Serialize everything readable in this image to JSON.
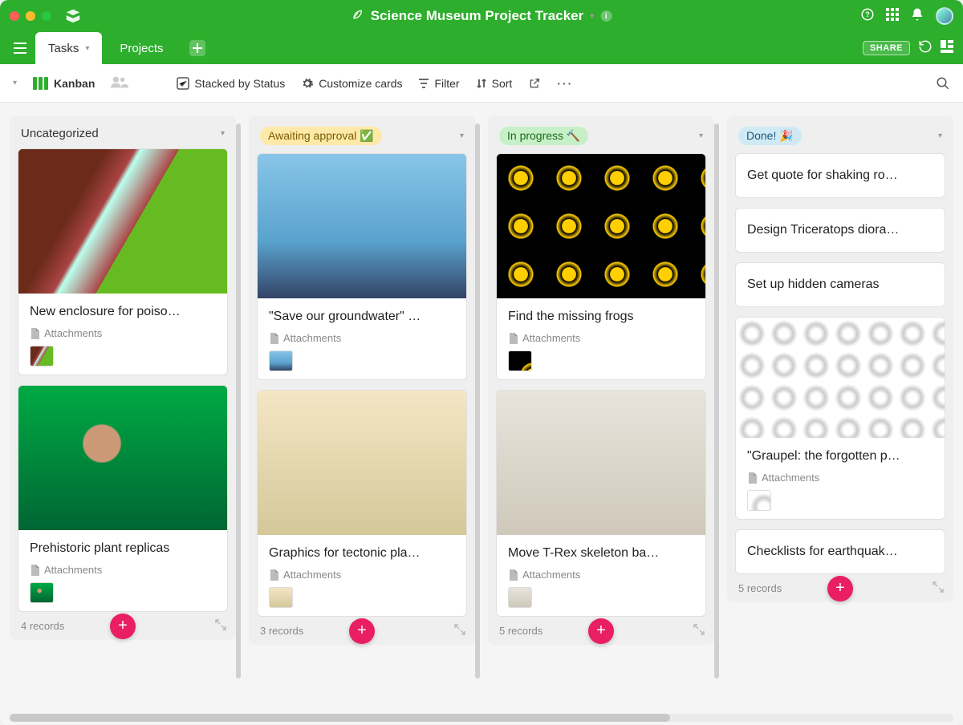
{
  "header": {
    "title": "Science Museum Project Tracker"
  },
  "tabs": {
    "tasks": "Tasks",
    "projects": "Projects"
  },
  "topbar_right": {
    "share": "SHARE"
  },
  "toolbar": {
    "view_name": "Kanban",
    "stacked": "Stacked by Status",
    "customize": "Customize cards",
    "filter": "Filter",
    "sort": "Sort"
  },
  "columns": [
    {
      "title": "Uncategorized",
      "pill_class": "",
      "emoji": "",
      "footer": "4 records",
      "cards": [
        {
          "title": "New enclosure for poiso…",
          "attachments": "Attachments",
          "image": "img-frog1",
          "has_image": true
        },
        {
          "title": "Prehistoric plant replicas",
          "attachments": "Attachments",
          "image": "img-plant",
          "has_image": true
        }
      ]
    },
    {
      "title": "Awaiting approval",
      "pill_class": "yellow",
      "emoji": "✅",
      "footer": "3 records",
      "cards": [
        {
          "title": "\"Save our groundwater\" …",
          "attachments": "Attachments",
          "image": "img-water",
          "has_image": true
        },
        {
          "title": "Graphics for tectonic pla…",
          "attachments": "Attachments",
          "image": "img-map",
          "has_image": true
        }
      ]
    },
    {
      "title": "In progress",
      "pill_class": "green",
      "emoji": "🔨",
      "footer": "5 records",
      "cards": [
        {
          "title": "Find the missing frogs",
          "attachments": "Attachments",
          "image": "img-frog2",
          "has_image": true
        },
        {
          "title": "Move T-Rex skeleton ba…",
          "attachments": "Attachments",
          "image": "img-trex",
          "has_image": true
        }
      ]
    },
    {
      "title": "Done!",
      "pill_class": "blue",
      "emoji": "🎉",
      "footer": "5 records",
      "cards": [
        {
          "title": "Get quote for shaking ro…",
          "has_image": false
        },
        {
          "title": "Design Triceratops diora…",
          "has_image": false
        },
        {
          "title": "Set up hidden cameras",
          "has_image": false
        },
        {
          "title": "\"Graupel: the forgotten p…",
          "attachments": "Attachments",
          "image": "img-graupel",
          "has_image": true,
          "short_image": true
        },
        {
          "title": "Checklists for earthquak…",
          "has_image": false
        }
      ]
    }
  ]
}
